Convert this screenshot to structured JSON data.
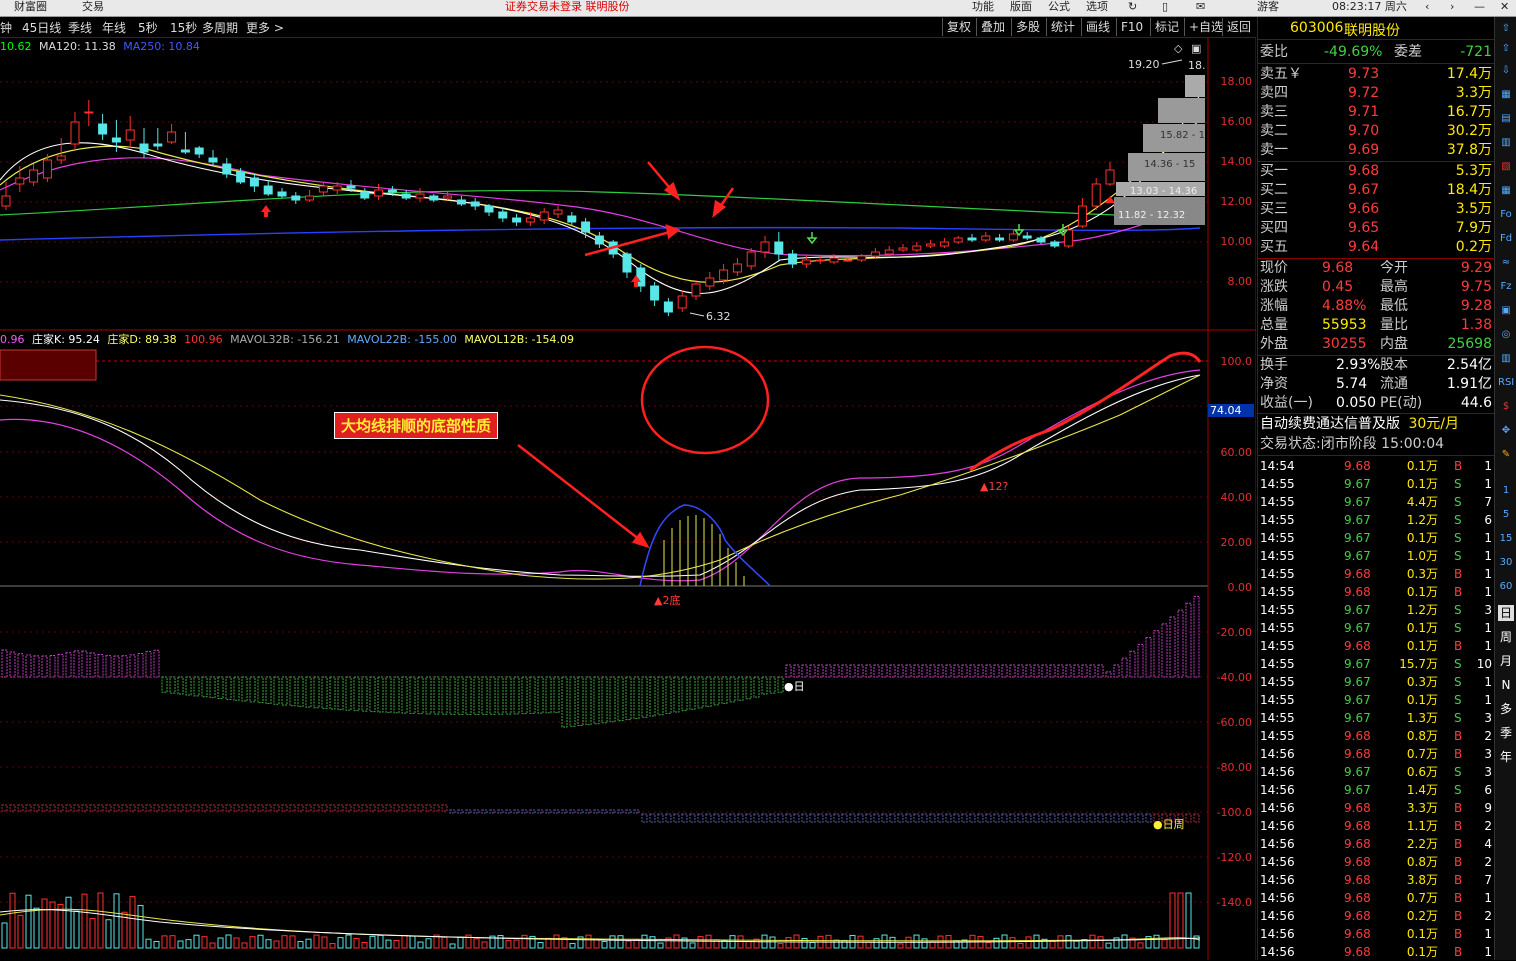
{
  "top": {
    "brand": "财富圈",
    "trade": "交易",
    "alert": "证券交易未登录  联明股份",
    "menu": [
      "功能",
      "版面",
      "公式",
      "选项"
    ],
    "clock": "08:23:17 周六",
    "guest": "游客"
  },
  "toolbar": {
    "periods": [
      "钟",
      "45日线",
      "季线",
      "年线",
      "5秒",
      "15秒",
      "多周期",
      "更多 >"
    ],
    "buttons": [
      "复权",
      "叠加",
      "多股",
      "统计",
      "画线",
      "F10",
      "标记",
      "+自选",
      "返回"
    ]
  },
  "main": {
    "ma_labels": [
      {
        "text": "10.62",
        "color": "#00ff00"
      },
      {
        "text": "MA120: 11.38",
        "color": "#dddddd"
      },
      {
        "text": "MA250: 10.84",
        "color": "#3d5bff"
      }
    ],
    "price_axis": [
      "18.00",
      "16.00",
      "14.00",
      "12.00",
      "10.00",
      "8.00"
    ],
    "annotations": {
      "high": "19.20",
      "high_right": "18.",
      "low": "6.32"
    },
    "chip_labels": [
      "15.82 - 1",
      "14.36 - 15",
      "13.03 - 14.36",
      "11.82 - 12.32"
    ]
  },
  "indicator": {
    "labels": [
      {
        "text": "0.96",
        "color": "#ff55ff"
      },
      {
        "text": "庄家K: 95.24",
        "color": "#ffffff"
      },
      {
        "text": "庄家D: 89.38",
        "color": "#ffff66"
      },
      {
        "text": "100.96",
        "color": "#ff3333"
      },
      {
        "text": "MAVOL32B: -156.21",
        "color": "#aaaaaa"
      },
      {
        "text": "MAVOL22B: -155.00",
        "color": "#66aaff"
      },
      {
        "text": "MAVOL12B: -154.09",
        "color": "#ffff66"
      }
    ],
    "axis": [
      "100.0",
      "80.00",
      "60.00",
      "40.00",
      "20.00",
      "0.00",
      "-20.00",
      "-40.00",
      "-60.00",
      "-80.00",
      "-100.0",
      "-120.0",
      "-140.0"
    ],
    "current_value": "74.04",
    "callout": "大均线排顺的底部性质",
    "markers": {
      "bottom": "▲2底",
      "twelve": "▲12?",
      "day": "●日",
      "dayweek": "●日周"
    }
  },
  "quote": {
    "code": "603006",
    "name": "联明股份",
    "weibi_label": "委比",
    "weibi": "-49.69%",
    "weicha_label": "委差",
    "weicha": "-721",
    "asks": [
      {
        "label": "卖五￥",
        "price": "9.73",
        "vol": "17.4万"
      },
      {
        "label": "卖四",
        "price": "9.72",
        "vol": "3.3万"
      },
      {
        "label": "卖三",
        "price": "9.71",
        "vol": "16.7万"
      },
      {
        "label": "卖二",
        "price": "9.70",
        "vol": "30.2万"
      },
      {
        "label": "卖一",
        "price": "9.69",
        "vol": "37.8万"
      }
    ],
    "bids": [
      {
        "label": "买一",
        "price": "9.68",
        "vol": "5.3万"
      },
      {
        "label": "买二",
        "price": "9.67",
        "vol": "18.4万"
      },
      {
        "label": "买三",
        "price": "9.66",
        "vol": "3.5万"
      },
      {
        "label": "买四",
        "price": "9.65",
        "vol": "7.9万"
      },
      {
        "label": "买五",
        "price": "9.64",
        "vol": "0.2万"
      }
    ],
    "stats": [
      {
        "l1": "现价",
        "v1": "9.68",
        "c1": "red",
        "l2": "今开",
        "v2": "9.29",
        "c2": "red"
      },
      {
        "l1": "涨跌",
        "v1": "0.45",
        "c1": "red",
        "l2": "最高",
        "v2": "9.75",
        "c2": "red"
      },
      {
        "l1": "涨幅",
        "v1": "4.88%",
        "c1": "red",
        "l2": "最低",
        "v2": "9.28",
        "c2": "red"
      },
      {
        "l1": "总量",
        "v1": "55953",
        "c1": "yellow",
        "l2": "量比",
        "v2": "1.38",
        "c2": "red"
      },
      {
        "l1": "外盘",
        "v1": "30255",
        "c1": "red",
        "l2": "内盘",
        "v2": "25698",
        "c2": "green"
      }
    ],
    "stats2": [
      {
        "l1": "换手",
        "v1": "2.93%",
        "l2": "股本",
        "v2": "2.54亿"
      },
      {
        "l1": "净资",
        "v1": "5.74",
        "l2": "流通",
        "v2": "1.91亿"
      },
      {
        "l1": "收益(一)",
        "v1": "0.050",
        "l2": "PE(动)",
        "v2": "44.6"
      }
    ],
    "promo": "自动续费通达信普及版",
    "promo_price": "30元/月",
    "status": "交易状态:闭市阶段 15:00:04"
  },
  "ticks": [
    {
      "t": "14:54",
      "p": "9.68",
      "v": "0.1万",
      "d": "B",
      "n": "1"
    },
    {
      "t": "14:55",
      "p": "9.67",
      "v": "0.1万",
      "d": "S",
      "n": "1"
    },
    {
      "t": "14:55",
      "p": "9.67",
      "v": "4.4万",
      "d": "S",
      "n": "7"
    },
    {
      "t": "14:55",
      "p": "9.67",
      "v": "1.2万",
      "d": "S",
      "n": "6"
    },
    {
      "t": "14:55",
      "p": "9.67",
      "v": "0.1万",
      "d": "S",
      "n": "1"
    },
    {
      "t": "14:55",
      "p": "9.67",
      "v": "1.0万",
      "d": "S",
      "n": "1"
    },
    {
      "t": "14:55",
      "p": "9.68",
      "v": "0.3万",
      "d": "B",
      "n": "1"
    },
    {
      "t": "14:55",
      "p": "9.68",
      "v": "0.1万",
      "d": "B",
      "n": "1"
    },
    {
      "t": "14:55",
      "p": "9.67",
      "v": "1.2万",
      "d": "S",
      "n": "3"
    },
    {
      "t": "14:55",
      "p": "9.67",
      "v": "0.1万",
      "d": "S",
      "n": "1"
    },
    {
      "t": "14:55",
      "p": "9.68",
      "v": "0.1万",
      "d": "B",
      "n": "1"
    },
    {
      "t": "14:55",
      "p": "9.67",
      "v": "15.7万",
      "d": "S",
      "n": "10"
    },
    {
      "t": "14:55",
      "p": "9.67",
      "v": "0.3万",
      "d": "S",
      "n": "1"
    },
    {
      "t": "14:55",
      "p": "9.67",
      "v": "0.1万",
      "d": "S",
      "n": "1"
    },
    {
      "t": "14:55",
      "p": "9.67",
      "v": "1.3万",
      "d": "S",
      "n": "3"
    },
    {
      "t": "14:55",
      "p": "9.68",
      "v": "0.8万",
      "d": "B",
      "n": "2"
    },
    {
      "t": "14:56",
      "p": "9.68",
      "v": "0.7万",
      "d": "B",
      "n": "3"
    },
    {
      "t": "14:56",
      "p": "9.67",
      "v": "0.6万",
      "d": "S",
      "n": "3"
    },
    {
      "t": "14:56",
      "p": "9.67",
      "v": "1.4万",
      "d": "S",
      "n": "6"
    },
    {
      "t": "14:56",
      "p": "9.68",
      "v": "3.3万",
      "d": "B",
      "n": "9"
    },
    {
      "t": "14:56",
      "p": "9.68",
      "v": "1.1万",
      "d": "B",
      "n": "2"
    },
    {
      "t": "14:56",
      "p": "9.68",
      "v": "2.2万",
      "d": "B",
      "n": "4"
    },
    {
      "t": "14:56",
      "p": "9.68",
      "v": "0.8万",
      "d": "B",
      "n": "2"
    },
    {
      "t": "14:56",
      "p": "9.68",
      "v": "3.8万",
      "d": "B",
      "n": "7"
    },
    {
      "t": "14:56",
      "p": "9.68",
      "v": "0.7万",
      "d": "B",
      "n": "1"
    },
    {
      "t": "14:56",
      "p": "9.68",
      "v": "0.2万",
      "d": "B",
      "n": "2"
    },
    {
      "t": "14:56",
      "p": "9.68",
      "v": "0.1万",
      "d": "B",
      "n": "1"
    },
    {
      "t": "14:56",
      "p": "9.68",
      "v": "0.1万",
      "d": "B",
      "n": "1"
    }
  ],
  "sidebar": [
    "日",
    "周",
    "月",
    "N",
    "多",
    "季",
    "年"
  ]
}
